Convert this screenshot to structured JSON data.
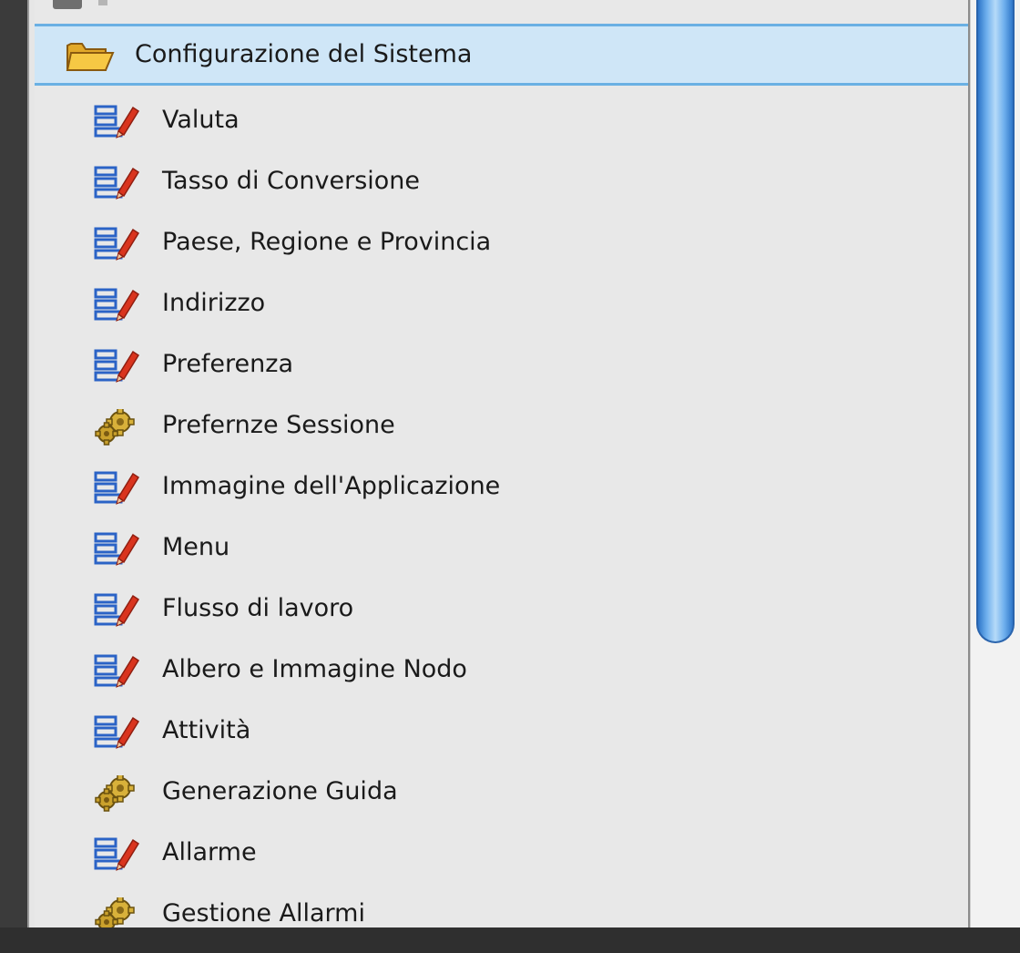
{
  "tree": {
    "root": {
      "label": "Configurazione del Sistema",
      "icon": "folder-open-icon"
    },
    "items": [
      {
        "label": "Valuta",
        "icon": "window-form-icon"
      },
      {
        "label": "Tasso di Conversione",
        "icon": "window-form-icon"
      },
      {
        "label": "Paese, Regione e Provincia",
        "icon": "window-form-icon"
      },
      {
        "label": "Indirizzo",
        "icon": "window-form-icon"
      },
      {
        "label": "Preferenza",
        "icon": "window-form-icon"
      },
      {
        "label": "Prefernze Sessione",
        "icon": "gears-process-icon"
      },
      {
        "label": "Immagine dell'Applicazione",
        "icon": "window-form-icon"
      },
      {
        "label": "Menu",
        "icon": "window-form-icon"
      },
      {
        "label": "Flusso di lavoro",
        "icon": "window-form-icon"
      },
      {
        "label": "Albero e Immagine Nodo",
        "icon": "window-form-icon"
      },
      {
        "label": "Attività",
        "icon": "window-form-icon"
      },
      {
        "label": "Generazione Guida",
        "icon": "gears-process-icon"
      },
      {
        "label": "Allarme",
        "icon": "window-form-icon"
      },
      {
        "label": "Gestione Allarmi",
        "icon": "gears-process-icon"
      }
    ]
  },
  "colors": {
    "selection_bg": "#cfe6f7",
    "selection_border": "#6ab0e3",
    "panel_bg": "#e8e8e8",
    "form_icon_blue": "#2b63c6",
    "form_icon_red": "#d9341e",
    "gear_gold": "#d8b13a",
    "folder_yellow": "#f6c844"
  }
}
